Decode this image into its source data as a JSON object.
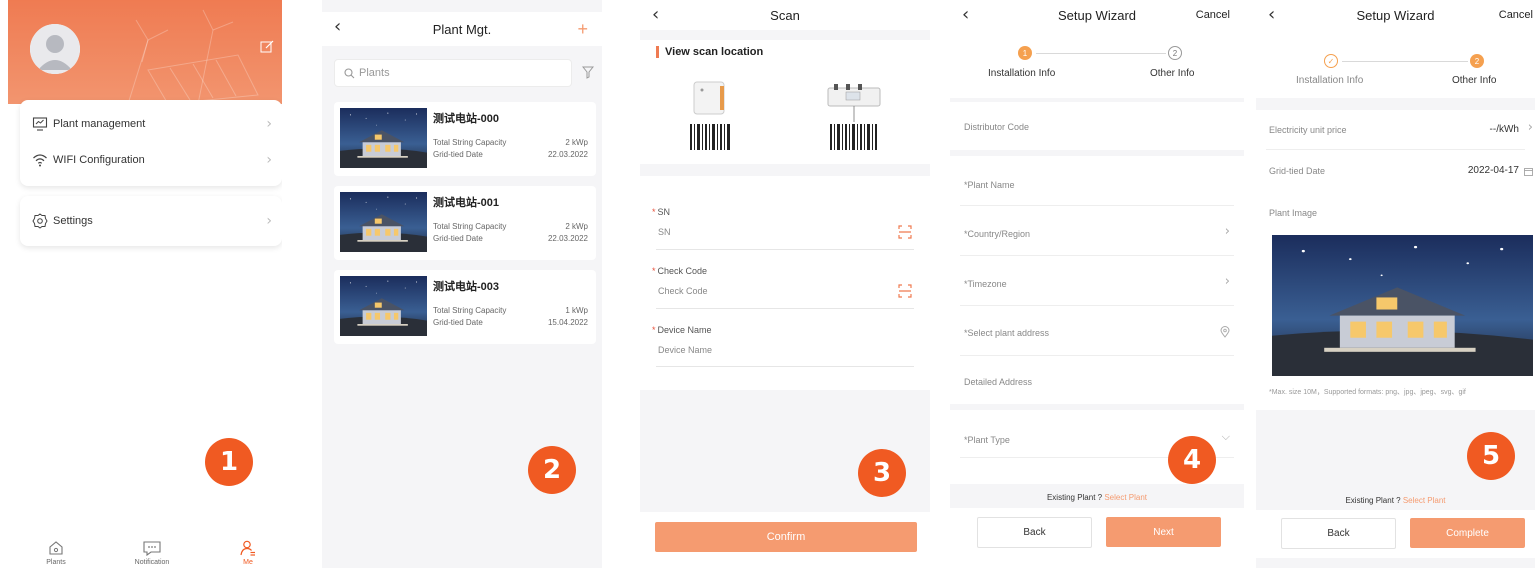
{
  "colors": {
    "accent": "#f05a22",
    "primary_button": "#f59b70",
    "header": "#ef7b52"
  },
  "badges": [
    "1",
    "2",
    "3",
    "4",
    "5"
  ],
  "screen1": {
    "menu": [
      {
        "label": "Plant management",
        "icon": "monitor-icon"
      },
      {
        "label": "WIFI Configuration",
        "icon": "wifi-icon"
      }
    ],
    "settings_label": "Settings",
    "tabs": [
      {
        "label": "Plants",
        "icon": "home-icon"
      },
      {
        "label": "Notification",
        "icon": "chat-icon"
      },
      {
        "label": "Me",
        "icon": "person-icon",
        "active": true
      }
    ]
  },
  "screen2": {
    "title": "Plant Mgt.",
    "add": "+",
    "search_placeholder": "Plants",
    "plants": [
      {
        "name": "测试电站-000",
        "capacity_label": "Total String Capacity",
        "capacity": "2 kWp",
        "date_label": "Grid-tied Date",
        "date": "22.03.2022"
      },
      {
        "name": "测试电站-001",
        "capacity_label": "Total String Capacity",
        "capacity": "2 kWp",
        "date_label": "Grid-tied Date",
        "date": "22.03.2022"
      },
      {
        "name": "测试电站-003",
        "capacity_label": "Total String Capacity",
        "capacity": "1 kWp",
        "date_label": "Grid-tied Date",
        "date": "15.04.2022"
      }
    ]
  },
  "screen3": {
    "title": "Scan",
    "section_title": "View scan location",
    "fields": [
      {
        "label": "SN",
        "placeholder": "SN"
      },
      {
        "label": "Check Code",
        "placeholder": "Check Code"
      },
      {
        "label": "Device Name",
        "placeholder": "Device Name"
      }
    ],
    "confirm": "Confirm"
  },
  "screen4": {
    "title": "Setup Wizard",
    "cancel": "Cancel",
    "steps": [
      {
        "num": "1",
        "label": "Installation Info"
      },
      {
        "num": "2",
        "label": "Other Info"
      }
    ],
    "fields": [
      "Distributor Code",
      "*Plant Name",
      "*Country/Region",
      "*Timezone",
      "*Select plant address",
      "Detailed Address",
      "*Plant Type"
    ],
    "existing_text": "Existing Plant ?",
    "existing_link": "Select Plant",
    "back": "Back",
    "next": "Next"
  },
  "screen5": {
    "title": "Setup Wizard",
    "cancel": "Cancel",
    "steps": [
      {
        "num": "✓",
        "label": "Installation Info"
      },
      {
        "num": "2",
        "label": "Other Info"
      }
    ],
    "price_label": "Electricity unit price",
    "price_value": "--/kWh",
    "date_label": "Grid-tied Date",
    "date_value": "2022-04-17",
    "image_label": "Plant Image",
    "image_note": "*Max. size 10M，Supported formats: png、jpg、jpeg、svg、gif",
    "existing_text": "Existing Plant ?",
    "existing_link": "Select Plant",
    "back": "Back",
    "complete": "Complete"
  }
}
